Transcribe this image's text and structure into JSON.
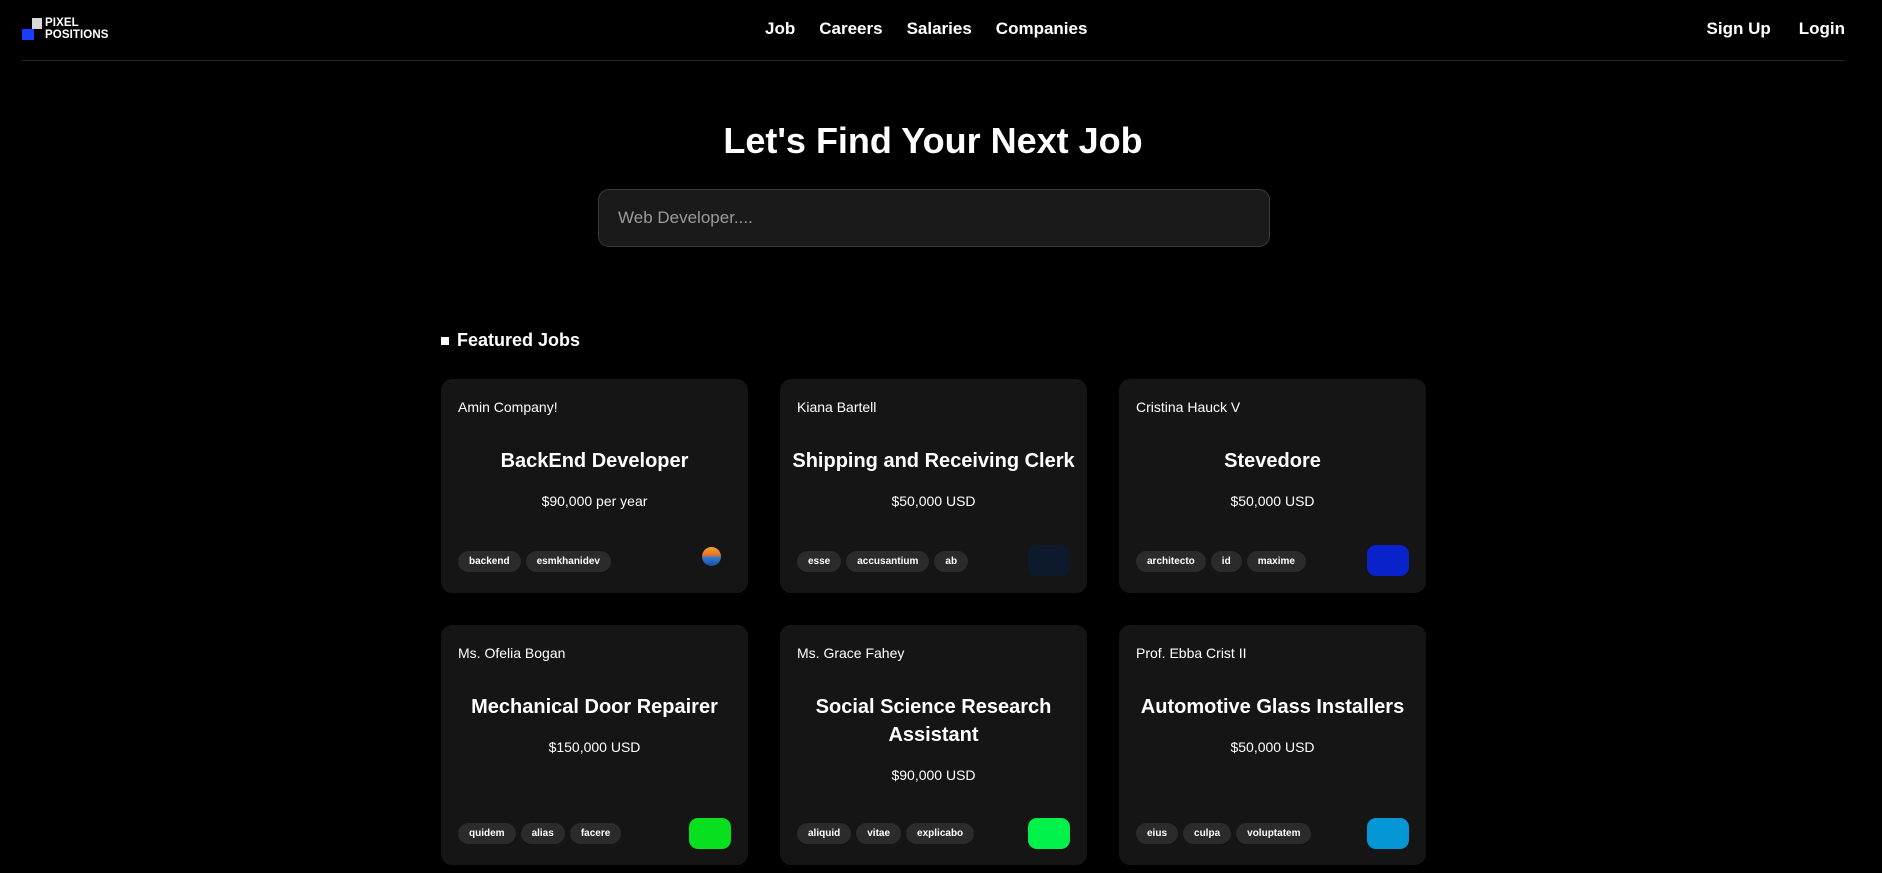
{
  "nav": {
    "logo_line1": "PIXEL",
    "logo_line2": "POSITIONS",
    "links": [
      "Job",
      "Careers",
      "Salaries",
      "Companies"
    ],
    "sign_up": "Sign Up",
    "login": "Login"
  },
  "hero": {
    "title": "Let's Find Your Next Job",
    "search_placeholder": "Web Developer...."
  },
  "featured": {
    "heading": "Featured Jobs",
    "jobs": [
      {
        "employer": "Amin Company!",
        "title": "BackEnd Developer",
        "salary": "$90,000 per year",
        "tags": [
          "backend",
          "esmkhanidev"
        ],
        "logo": "sunset-avatar-icon",
        "logo_color": "#e36f27"
      },
      {
        "employer": "Kiana Bartell",
        "title": "Shipping and Receiving Clerk",
        "salary": "$50,000 USD",
        "tags": [
          "esse",
          "accusantium",
          "ab"
        ],
        "logo": "company-logo",
        "logo_color": "#0c1a2b"
      },
      {
        "employer": "Cristina Hauck V",
        "title": "Stevedore",
        "salary": "$50,000 USD",
        "tags": [
          "architecto",
          "id",
          "maxime"
        ],
        "logo": "company-logo",
        "logo_color": "#0a22c9"
      },
      {
        "employer": "Ms. Ofelia Bogan",
        "title": "Mechanical Door Repairer",
        "salary": "$150,000 USD",
        "tags": [
          "quidem",
          "alias",
          "facere"
        ],
        "logo": "company-logo",
        "logo_color": "#08e01f"
      },
      {
        "employer": "Ms. Grace Fahey",
        "title": "Social Science Research Assistant",
        "salary": "$90,000 USD",
        "tags": [
          "aliquid",
          "vitae",
          "explicabo"
        ],
        "logo": "company-logo",
        "logo_color": "#00f24a"
      },
      {
        "employer": "Prof. Ebba Crist II",
        "title": "Automotive Glass Installers",
        "salary": "$50,000 USD",
        "tags": [
          "eius",
          "culpa",
          "voluptatem"
        ],
        "logo": "company-logo",
        "logo_color": "#0596d6"
      }
    ]
  }
}
